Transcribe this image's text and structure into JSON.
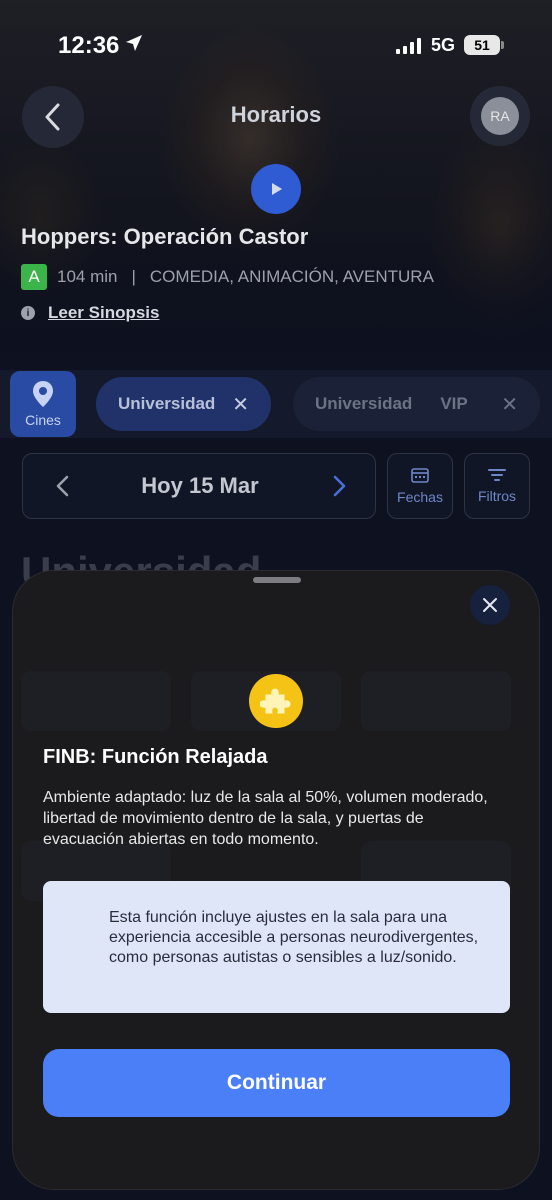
{
  "status_bar": {
    "time": "12:36",
    "network": "5G",
    "battery": "51",
    "icons": [
      "location-arrow-icon",
      "signal-icon",
      "battery-icon"
    ]
  },
  "header": {
    "title": "Horarios",
    "avatar_initials": "RA",
    "back_icon": "chevron-left-icon",
    "play_icon": "play-icon"
  },
  "movie": {
    "title": "Hoppers: Operación Castor",
    "rating": "A",
    "duration": "104 min",
    "separator": "|",
    "genres": "COMEDIA, ANIMACIÓN, AVENTURA",
    "synopsis_link": "Leer Sinopsis"
  },
  "cinemas": {
    "tab_label": "Cines",
    "chips": [
      {
        "label": "Universidad",
        "suffix": "",
        "active": true
      },
      {
        "label": "Universidad",
        "suffix": "VIP",
        "active": false
      }
    ]
  },
  "date_nav": {
    "label": "Hoy 15 Mar",
    "fechas_label": "Fechas",
    "filtros_label": "Filtros"
  },
  "section_peek": "Universidad",
  "sheet": {
    "title": "FINB: Función Relajada",
    "description": "Ambiente adaptado: luz de la sala al 50%, volumen moderado, libertad de movimiento dentro de la sala, y puertas de evacuación abiertas en todo momento.",
    "note": "Esta función incluye ajustes en la sala para una experiencia accesible a personas neurodivergentes, como personas autistas o sensibles a luz/sonido.",
    "button_label": "Continuar",
    "icon": "puzzle-piece-icon"
  },
  "colors": {
    "accent": "#4a7ff7",
    "chip_active": "#21326a",
    "puzzle": "#f5c216",
    "note_bg": "#dfe6f8"
  }
}
